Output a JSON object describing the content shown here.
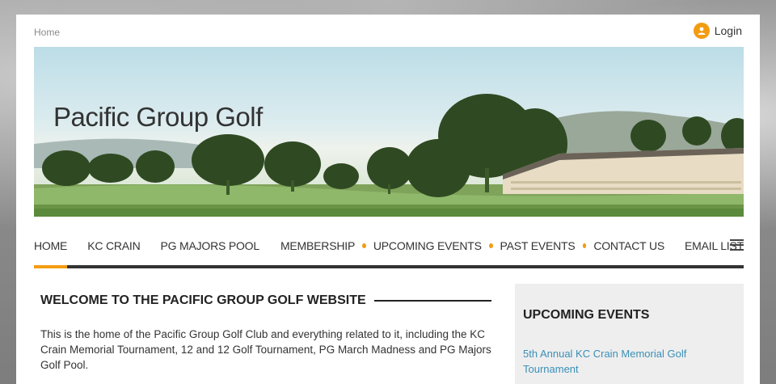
{
  "breadcrumb": "Home",
  "login": {
    "label": "Login",
    "icon": "user-icon"
  },
  "banner": {
    "title": "Pacific Group Golf"
  },
  "nav": {
    "items": [
      "HOME",
      "KC CRAIN",
      "PG MAJORS POOL",
      "MEMBERSHIP",
      "UPCOMING EVENTS",
      "PAST EVENTS",
      "CONTACT US",
      "EMAIL LIST"
    ],
    "active": "HOME",
    "menu_icon": "hamburger-icon"
  },
  "welcome": {
    "title": "WELCOME TO THE PACIFIC GROUP GOLF WEBSITE",
    "body": "This is the home of the Pacific Group Golf Club and everything related to it, including the KC Crain Memorial Tournament, 12 and 12 Golf Tournament, PG March Madness and PG Majors Golf Pool."
  },
  "sidebar": {
    "title": "UPCOMING EVENTS",
    "events": [
      "5th Annual KC Crain Memorial Golf Tournament"
    ]
  },
  "colors": {
    "accent": "#f39c12",
    "link": "#3a8fb7",
    "text": "#333333"
  }
}
